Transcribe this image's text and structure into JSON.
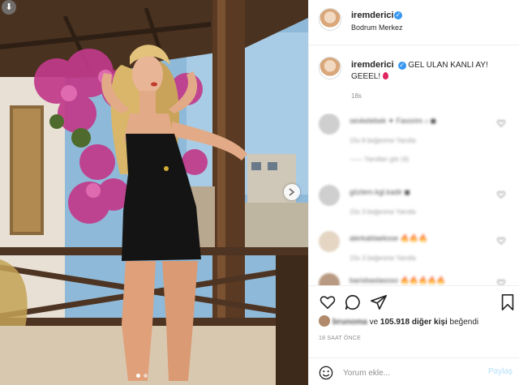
{
  "post": {
    "username": "iremderici",
    "location": "Bodrum Merkez",
    "caption": "GEL ULAN KANLI AY! GEEEL!",
    "caption_time": "18s"
  },
  "comments": [
    {
      "text": "sevkelebek ✦ Favorim ♪ ◼",
      "meta": "15s  8 beğenme  Yanıtla",
      "replies": "—— Yanıtları gör (4)"
    },
    {
      "text": "gözlem.kgl.kadir ◼",
      "meta": "15s  3 beğenme  Yanıtla",
      "replies": ""
    },
    {
      "text": "alerkablaeksse 🔥🔥🔥",
      "meta": "15s  3 beğenme  Yanıtla",
      "replies": ""
    },
    {
      "text": "barisbaslasoso 🔥🔥🔥🔥🔥",
      "meta": "",
      "replies": ""
    }
  ],
  "likes": {
    "blurred_name": "brunoma",
    "connector": "ve",
    "count": "105.918 diğer kişi",
    "suffix": "beğendi"
  },
  "time_ago": "18 SAAT ÖNCE",
  "comment_input": {
    "placeholder": "Yorum ekle..."
  },
  "share_label": "Paylaş",
  "icons": [
    "heart-icon",
    "comment-icon",
    "send-icon",
    "bookmark-icon",
    "emoji-icon",
    "chevron-right-icon",
    "verified-icon"
  ],
  "colors": {
    "link": "#3897f0",
    "share_disabled": "#b2dffc",
    "muted": "#8e8e8e",
    "drop": "#e0245e"
  }
}
